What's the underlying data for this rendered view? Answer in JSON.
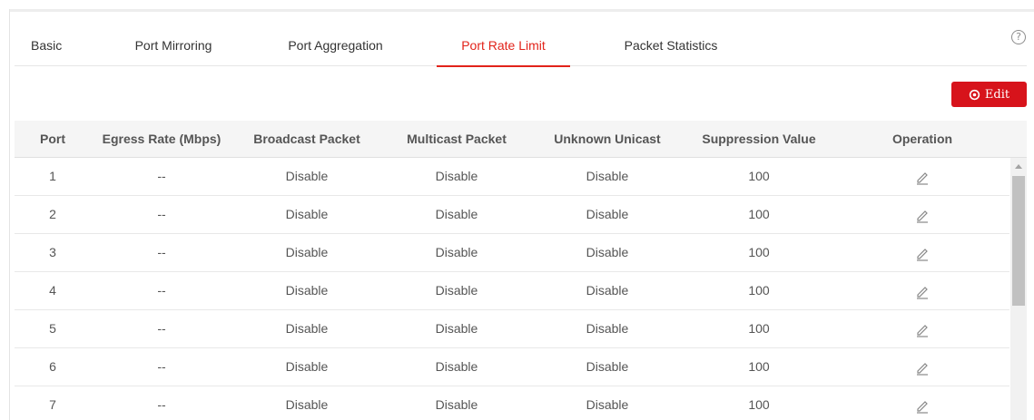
{
  "tabs": [
    {
      "label": "Basic"
    },
    {
      "label": "Port Mirroring"
    },
    {
      "label": "Port Aggregation"
    },
    {
      "label": "Port Rate Limit",
      "active": true
    },
    {
      "label": "Packet Statistics"
    }
  ],
  "help_icon": "question-circle-icon",
  "toolbar": {
    "edit_label": "Edit",
    "edit_icon": "gear-icon"
  },
  "accent_color": "#e2231a",
  "table": {
    "headers": [
      "Port",
      "Egress Rate (Mbps)",
      "Broadcast Packet",
      "Multicast Packet",
      "Unknown Unicast",
      "Suppression Value",
      "Operation"
    ],
    "rows": [
      {
        "port": "1",
        "egress": "--",
        "broadcast": "Disable",
        "multicast": "Disable",
        "unicast": "Disable",
        "suppression": "100"
      },
      {
        "port": "2",
        "egress": "--",
        "broadcast": "Disable",
        "multicast": "Disable",
        "unicast": "Disable",
        "suppression": "100"
      },
      {
        "port": "3",
        "egress": "--",
        "broadcast": "Disable",
        "multicast": "Disable",
        "unicast": "Disable",
        "suppression": "100"
      },
      {
        "port": "4",
        "egress": "--",
        "broadcast": "Disable",
        "multicast": "Disable",
        "unicast": "Disable",
        "suppression": "100"
      },
      {
        "port": "5",
        "egress": "--",
        "broadcast": "Disable",
        "multicast": "Disable",
        "unicast": "Disable",
        "suppression": "100"
      },
      {
        "port": "6",
        "egress": "--",
        "broadcast": "Disable",
        "multicast": "Disable",
        "unicast": "Disable",
        "suppression": "100"
      },
      {
        "port": "7",
        "egress": "--",
        "broadcast": "Disable",
        "multicast": "Disable",
        "unicast": "Disable",
        "suppression": "100"
      }
    ],
    "operation_icon": "pencil-icon"
  }
}
